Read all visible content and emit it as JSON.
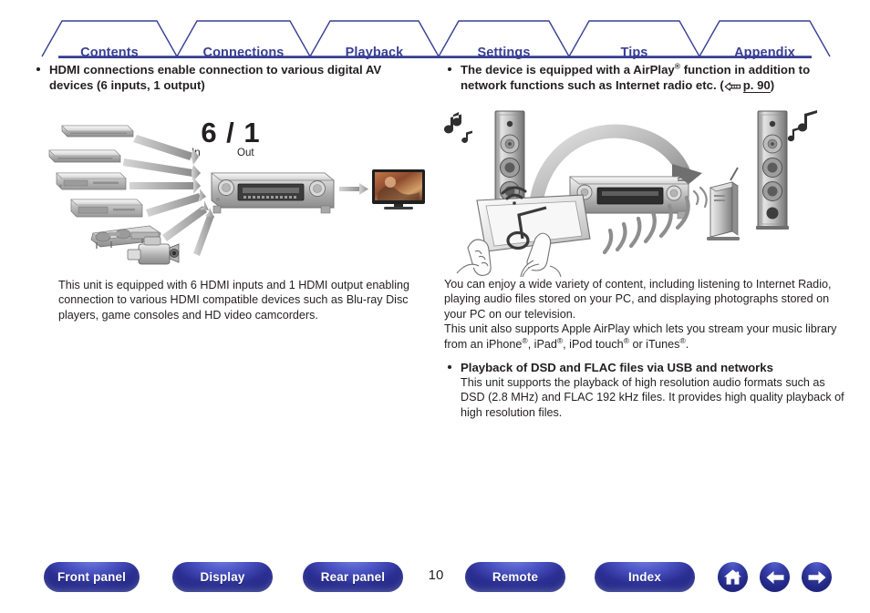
{
  "tabs": [
    {
      "label": "Contents"
    },
    {
      "label": "Connections"
    },
    {
      "label": "Playback"
    },
    {
      "label": "Settings"
    },
    {
      "label": "Tips"
    },
    {
      "label": "Appendix"
    }
  ],
  "left": {
    "heading_line1": "HDMI connections enable connection to various digital AV",
    "heading_line2": "devices (6 inputs, 1 output)",
    "figure": {
      "ratio_number": "6 / 1",
      "label_in": "In",
      "label_out": "Out",
      "alt": "Six HDMI source devices feeding one AV receiver with a single HDMI output to a television"
    },
    "caption": "This unit is equipped with 6 HDMI inputs and 1 HDMI output enabling connection to various HDMI compatible devices such as Blu-ray Disc players, game consoles and HD video camcorders."
  },
  "right": {
    "heading_line1_a": "The device is equipped with a AirPlay",
    "heading_line1_sup": "®",
    "heading_line1_b": " function in addition to",
    "heading_line2_a": "network functions such as Internet radio etc.  (",
    "heading_link_icon": "pointing-hand-icon",
    "heading_link_page": "p. 90",
    "heading_line2_b": ")",
    "figure": {
      "alt": "Tablet streaming music wirelessly through a router to an AV receiver driving two floorstanding speakers"
    },
    "para1": "You can enjoy a wide variety of content, including listening to Internet Radio, playing audio files stored on your PC, and displaying photographs stored on your PC on our television.",
    "para2_a": "This unit also supports Apple AirPlay which lets you stream your music library from an iPhone",
    "para2_b": ", iPad",
    "para2_c": ", iPod touch",
    "para2_d": " or iTunes",
    "para2_e": ".",
    "reg": "®",
    "heading2": "Playback of DSD and FLAC files via USB and networks",
    "para3": "This unit supports the playback of high resolution audio formats such as DSD (2.8 MHz) and FLAC 192 kHz files. It provides high quality playback of high resolution files."
  },
  "bottom": {
    "buttons": [
      {
        "label": "Front panel"
      },
      {
        "label": "Display"
      },
      {
        "label": "Rear panel"
      },
      {
        "label": "Remote"
      },
      {
        "label": "Index"
      }
    ],
    "page_number": "10",
    "icons": [
      {
        "name": "home-icon"
      },
      {
        "name": "arrow-left-icon"
      },
      {
        "name": "arrow-right-icon"
      }
    ]
  },
  "colors": {
    "navy": "#383f94",
    "navy_dark": "#232a86",
    "text": "#231f20"
  }
}
